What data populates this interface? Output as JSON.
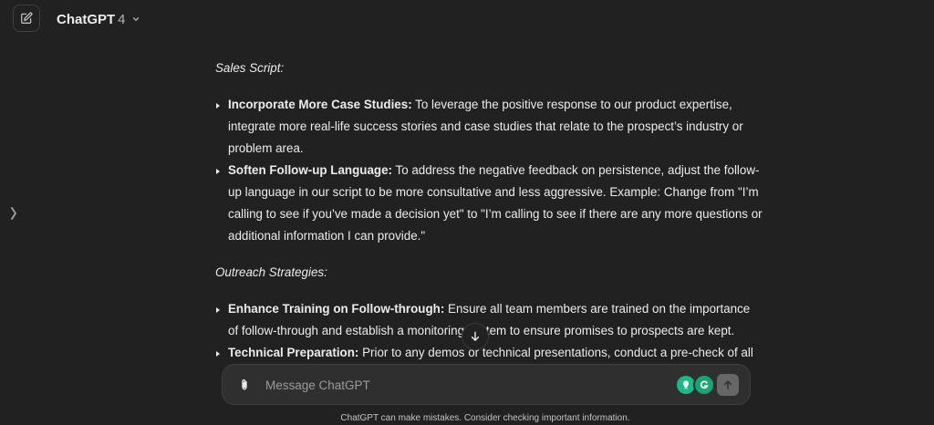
{
  "header": {
    "model_name": "ChatGPT",
    "model_version": "4",
    "new_chat_icon": "compose-icon",
    "dropdown_icon": "chevron-down-icon"
  },
  "sidebar": {
    "toggle_icon": "chevron-right-icon"
  },
  "content": {
    "sections": [
      {
        "heading": "Sales Script:",
        "items": [
          {
            "term": "Incorporate More Case Studies:",
            "text": " To leverage the positive response to our product expertise, integrate more real-life success stories and case studies that relate to the prospect’s industry or problem area."
          },
          {
            "term": "Soften Follow-up Language:",
            "text": " To address the negative feedback on persistence, adjust the follow-up language in our script to be more consultative and less aggressive. Example: Change from \"I’m calling to see if you’ve made a decision yet\" to \"I’m calling to see if there are any more questions or additional information I can provide.\""
          }
        ]
      },
      {
        "heading": "Outreach Strategies:",
        "items": [
          {
            "term": "Enhance Training on Follow-through:",
            "text": " Ensure all team members are trained on the importance of follow-through and establish a monitoring system to ensure promises to prospects are kept."
          },
          {
            "term": "Technical Preparation:",
            "text": " Prior to any demos or technical presentations, conduct a pre-check of all"
          }
        ]
      }
    ]
  },
  "composer": {
    "placeholder": "Message ChatGPT",
    "attach_icon": "paperclip-icon",
    "send_icon": "arrow-up-icon"
  },
  "scroll_button_icon": "arrow-down-icon",
  "footer": {
    "disclaimer": "ChatGPT can make mistakes. Consider checking important information."
  },
  "colors": {
    "background": "#212121",
    "composer_background": "#2f2f2f",
    "text": "#ececec",
    "muted_text": "#9b9b9b",
    "extension_green": "#15a673"
  }
}
